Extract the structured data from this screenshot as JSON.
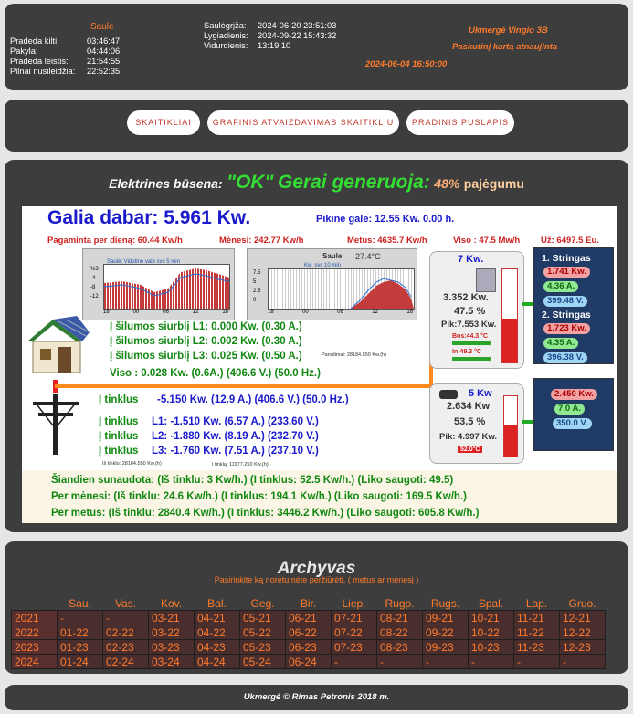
{
  "sun": {
    "title": "Saulė",
    "rows": [
      {
        "label": "Pradeda kilti:",
        "value": "03:46:47"
      },
      {
        "label": "Pakyla:",
        "value": "04:44:06"
      },
      {
        "label": "Pradeda leistis:",
        "value": "21:54:55"
      },
      {
        "label": "Pilnai nusileidžia:",
        "value": "22:52:35"
      }
    ],
    "events": [
      {
        "label": "Saulėgrįža:",
        "value": "2024-06-20 23:51:03"
      },
      {
        "label": "Lygiadienis:",
        "value": "2024-09-22 15:43:32"
      },
      {
        "label": "Vidurdienis:",
        "value": "13:19:10"
      }
    ]
  },
  "location": {
    "name": "Ukmergė Vingio 3B",
    "updated_label": "Paskutinį kartą atnaujinta",
    "updated_value": "2024-06-04 16:50:00"
  },
  "nav": {
    "items": [
      "SKAITIKLIAI",
      "GRAFINIS ATVAIZDAVIMAS SKAITIKLIU",
      "PRADINIS PUSLAPIS"
    ]
  },
  "status": {
    "prefix": "Elektrines būsena:",
    "ok": "\"OK\"",
    "text": "Gerai generuoja:",
    "percent": "48%",
    "suffix": "pajėgumu"
  },
  "power": {
    "now_label": "Galia dabar:",
    "now_value": "5.961 Kw.",
    "peak": "Pikine gale: 12.55 Kw. 0.00 h.",
    "per_day": "Pagaminta per dieną: 60.44 Kw/h",
    "month": "Mėnesi: 242.77 Kw/h",
    "year": "Metus: 4635.7 Kw/h",
    "total": "Viso : 47.5 Mw/h",
    "money": "Už: 6497.5 Eu."
  },
  "charts": {
    "left_title": "Saulė: Vidutinė vale svc 5 min",
    "left_yticks": [
      "%3",
      "-4",
      "-8",
      "-12"
    ],
    "left_xticks": [
      "18",
      "00",
      "06",
      "12",
      "18"
    ],
    "right_title": "Saule",
    "right_temp": "27.4°C",
    "right_subtitle": "Kw. svc 10 min",
    "right_yticks": [
      "7.5",
      "5",
      "2.5",
      "0"
    ],
    "right_xticks": [
      "18",
      "00",
      "06",
      "12",
      "18"
    ]
  },
  "heat": {
    "l1": "Į šilumos siurblį L1: 0.000 Kw. (0.30 A.)",
    "l2": "Į šilumos siurblį L2: 0.002 Kw. (0.30 A.)",
    "l3": "Į šilumos siurblį L3: 0.025 Kw. (0.50 A.)",
    "meter": "Parodimai: 28184.550 Kw.(h)",
    "total": "Viso : 0.028 Kw. (0.6A.) (406.6 V.) (50.0 Hz.)"
  },
  "grid": {
    "main_label": "Į tinklus",
    "main": "-5.150 Kw. (12.9 A.) (406.6 V.) (50.0 Hz.)",
    "rows": [
      {
        "label": "Į tinklus",
        "value": "L1: -1.510 Kw. (6.57 A.) (233.60 V.)"
      },
      {
        "label": "Į tinklus",
        "value": "L2: -1.880 Kw. (8.19 A.) (232.70 V.)"
      },
      {
        "label": "Į tinklus",
        "value": "L3: -1.760 Kw. (7.51 A.) (237.10 V.)"
      }
    ],
    "meter_from": "Iš tinklo: 28184.550 Kw.(h)",
    "meter_to": "I tinklą: 11977.250 Kw.(h)"
  },
  "inverter1": {
    "rating": "7 Kw.",
    "power": "3.352 Kw.",
    "percent": "47.5 %",
    "peak": "Pik:7.553 Kw.",
    "boost": "Bos:44.3 °C",
    "in": "In:49.3 °C",
    "fill": 0.475
  },
  "inverter2": {
    "rating": "5 Kw",
    "power": "2.634 Kw",
    "percent": "53.5 %",
    "peak": "Pik: 4.997 Kw.",
    "temp": "52.0°C",
    "fill": 0.535
  },
  "strings": {
    "s1_title": "1. Stringas",
    "s1_kw": "1.741 Kw.",
    "s1_a": "4.36 A.",
    "s1_v": "399.48 V.",
    "s2_title": "2. Stringas",
    "s2_kw": "1.723 Kw.",
    "s2_a": "4.35 A.",
    "s2_v": "396.38 V.",
    "s3_kw": "2.450 Kw.",
    "s3_a": "7.0 A.",
    "s3_v": "350.0 V."
  },
  "summary": {
    "today": "Šiandien sunaudota: (Iš tinklu: 3 Kw/h.) (I tinklus: 52.5 Kw/h.) (Liko saugoti: 49.5)",
    "month": "Per mėnesi: (Iš tinklu: 24.6 Kw/h.) (I tinklus: 194.1 Kw/h.) (Liko saugoti: 169.5 Kw/h.)",
    "year": "Per metus: (Iš tinklu: 2840.4 Kw/h.) (I tinklus: 3446.2 Kw/h.) (Liko saugoti: 605.8 Kw/h.)"
  },
  "archive": {
    "title": "Archyvas",
    "hint": "Pasirinkite ką norėtumėte peržiūrėti, ( metus ar mėnesį )",
    "months": [
      "Sau.",
      "Vas.",
      "Kov.",
      "Bal.",
      "Geg.",
      "Bir.",
      "Liep.",
      "Rugp.",
      "Rugs.",
      "Spal.",
      "Lap.",
      "Gruo."
    ],
    "rows": [
      {
        "year": "2021",
        "cells": [
          "-",
          "-",
          "03-21",
          "04-21",
          "05-21",
          "06-21",
          "07-21",
          "08-21",
          "09-21",
          "10-21",
          "11-21",
          "12-21"
        ]
      },
      {
        "year": "2022",
        "cells": [
          "01-22",
          "02-22",
          "03-22",
          "04-22",
          "05-22",
          "06-22",
          "07-22",
          "08-22",
          "09-22",
          "10-22",
          "11-22",
          "12-22"
        ]
      },
      {
        "year": "2023",
        "cells": [
          "01-23",
          "02-23",
          "03-23",
          "04-23",
          "05-23",
          "06-23",
          "07-23",
          "08-23",
          "09-23",
          "10-23",
          "11-23",
          "12-23"
        ]
      },
      {
        "year": "2024",
        "cells": [
          "01-24",
          "02-24",
          "03-24",
          "04-24",
          "05-24",
          "06-24",
          "-",
          "-",
          "-",
          "-",
          "-",
          "-"
        ]
      }
    ]
  },
  "footer": "Ukmergė © Rimas Petronis 2018 m."
}
